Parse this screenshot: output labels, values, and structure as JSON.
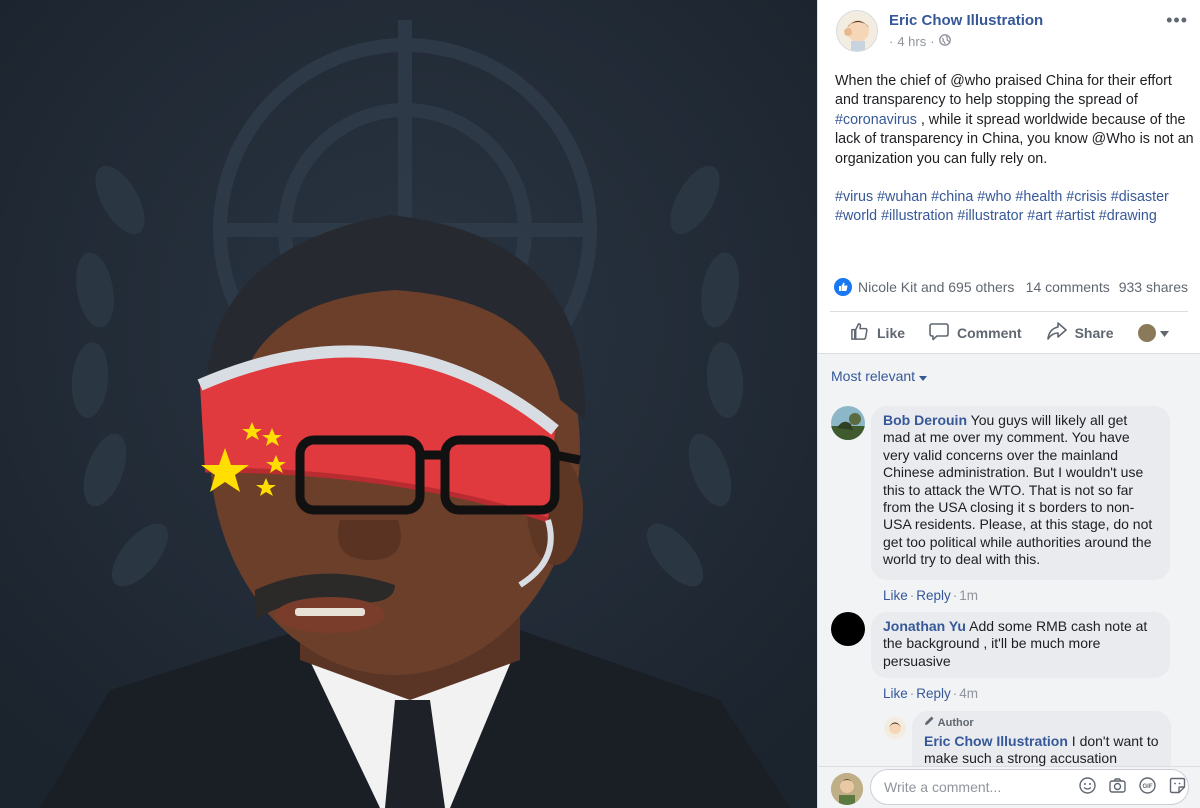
{
  "post": {
    "author": "Eric Chow Illustration",
    "time": "4 hrs",
    "separator": "·",
    "body_parts": [
      {
        "t": "When the chief of @who praised China for their effort and transparency to help stopping the spread of ",
        "tag": false
      },
      {
        "t": "#coronavirus",
        "tag": true
      },
      {
        "t": " , while it spread worldwide because of the lack of transparency in China, you know @Who is not an organization you can fully rely on.",
        "tag": false
      }
    ],
    "hashtags_line1": "#virus #wuhan #china #who #health #crisis #disaster",
    "hashtags_line2": "#world #illustration #illustrator #art #artist #drawing"
  },
  "stats": {
    "reactions": "Nicole Kit and 695 others",
    "comments": "14 comments",
    "shares": "933 shares"
  },
  "actions": {
    "like": "Like",
    "comment": "Comment",
    "share": "Share"
  },
  "sort": {
    "label": "Most relevant"
  },
  "comments": [
    {
      "name": "Bob Derouin",
      "text": "You guys will likely all get mad at me over my comment. You have very valid concerns over the mainland Chinese administration. But I wouldn't use this to attack the WTO. That is not so far from the USA closing it s borders to non-USA residents. Please, at this stage, do not get too political while authorities around the world try to deal with this.",
      "like": "Like",
      "reply": "Reply",
      "time": "1m"
    },
    {
      "name": "Jonathan Yu",
      "text": "Add some RMB cash note at the background , it'll be much more persuasive",
      "like": "Like",
      "reply": "Reply",
      "time": "4m"
    },
    {
      "badge": "Author",
      "name": "Eric Chow Illustration",
      "text": "I don't want to make such a strong accusation"
    }
  ],
  "composer": {
    "placeholder": "Write a comment..."
  },
  "colors": {
    "link": "#365899",
    "background": "#212b36",
    "mask_red": "#e0393e"
  }
}
